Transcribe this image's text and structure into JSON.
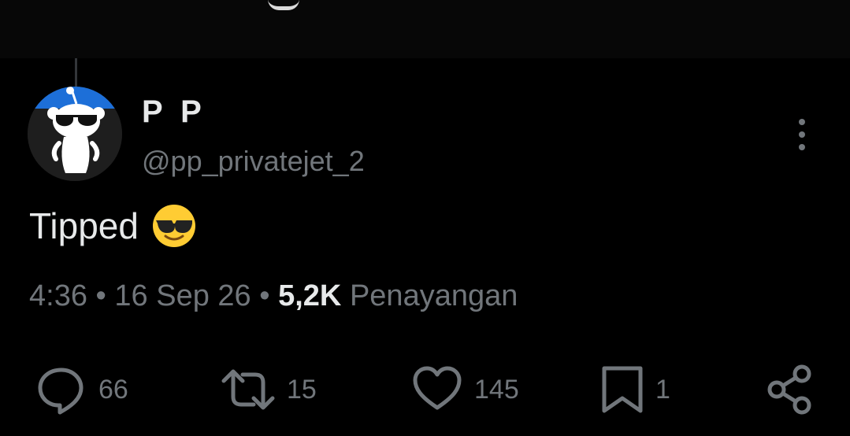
{
  "post": {
    "author_name": "P P",
    "author_handle": "@pp_privatejet_2",
    "text": "Tipped",
    "emoji": "smiling-face-with-sunglasses",
    "time": "4:36",
    "date": "16 Sep 26",
    "separator": "•",
    "views_count": "5,2K",
    "views_label": "Penayangan"
  },
  "actions": {
    "replies": "66",
    "reposts": "15",
    "likes": "145",
    "bookmarks": "1"
  },
  "colors": {
    "background": "#000000",
    "text_primary": "#e7e9ea",
    "text_secondary": "#71767b",
    "emoji_yellow": "#ffcc33",
    "avatar_blue": "#1d6fd8"
  }
}
